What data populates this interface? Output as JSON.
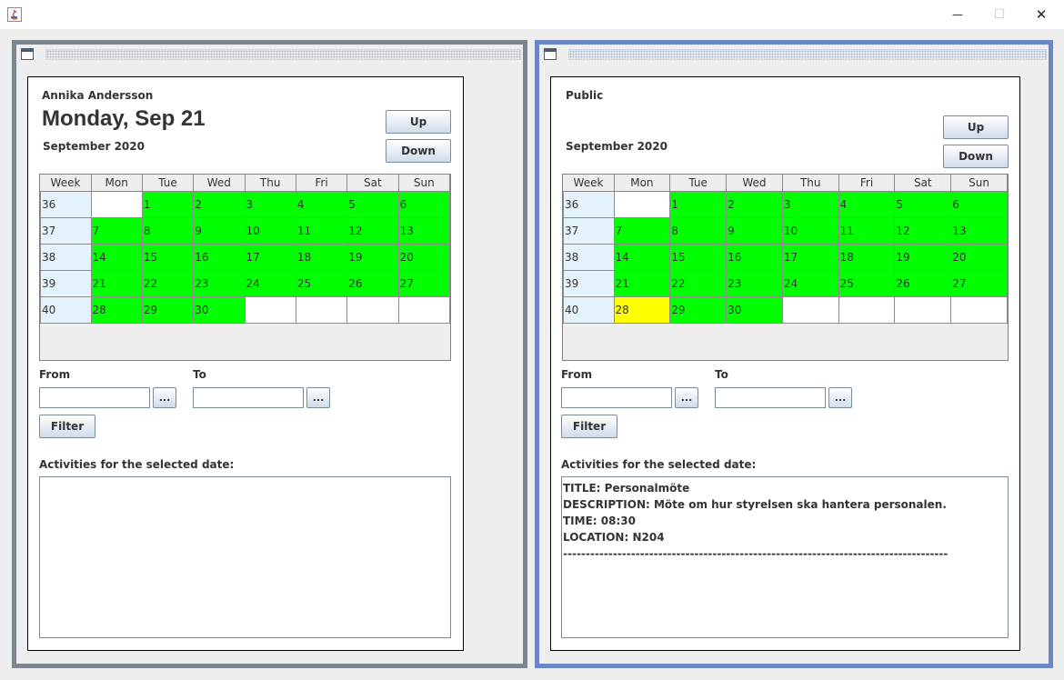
{
  "window": {
    "minimize_glyph": "—",
    "maximize_glyph": "☐",
    "close_glyph": "✕",
    "app_icon": "java-icon"
  },
  "calendar_common": {
    "weekday_headers": [
      "Week",
      "Mon",
      "Tue",
      "Wed",
      "Thu",
      "Fri",
      "Sat",
      "Sun"
    ]
  },
  "left": {
    "user_name": "Annika Andersson",
    "selected_date_label": "Monday, Sep 21",
    "month_label": "September  2020",
    "up_label": "Up",
    "down_label": "Down",
    "from_label": "From",
    "to_label": "To",
    "ellipsis_label": "...",
    "filter_label": "Filter",
    "activities_label": "Activities for the selected date:",
    "rows": [
      {
        "week": "36",
        "days": [
          "",
          "1",
          "2",
          "3",
          "4",
          "5",
          "6"
        ]
      },
      {
        "week": "37",
        "days": [
          "7",
          "8",
          "9",
          "10",
          "11",
          "12",
          "13"
        ]
      },
      {
        "week": "38",
        "days": [
          "14",
          "15",
          "16",
          "17",
          "18",
          "19",
          "20"
        ]
      },
      {
        "week": "39",
        "days": [
          "21",
          "22",
          "23",
          "24",
          "25",
          "26",
          "27"
        ]
      },
      {
        "week": "40",
        "days": [
          "28",
          "29",
          "30",
          "",
          "",
          "",
          ""
        ]
      }
    ],
    "activities": []
  },
  "right": {
    "calendar_name": "Public",
    "month_label": "September  2020",
    "up_label": "Up",
    "down_label": "Down",
    "from_label": "From",
    "to_label": "To",
    "ellipsis_label": "...",
    "filter_label": "Filter",
    "activities_label": "Activities for the selected date:",
    "selected_day": "28",
    "rows": [
      {
        "week": "36",
        "days": [
          "",
          "1",
          "2",
          "3",
          "4",
          "5",
          "6"
        ]
      },
      {
        "week": "37",
        "days": [
          "7",
          "8",
          "9",
          "10",
          "11",
          "12",
          "13"
        ]
      },
      {
        "week": "38",
        "days": [
          "14",
          "15",
          "16",
          "17",
          "18",
          "19",
          "20"
        ]
      },
      {
        "week": "39",
        "days": [
          "21",
          "22",
          "23",
          "24",
          "25",
          "26",
          "27"
        ]
      },
      {
        "week": "40",
        "days": [
          "28",
          "29",
          "30",
          "",
          "",
          "",
          ""
        ]
      }
    ],
    "activities": [
      "TITLE: Personalmöte",
      "DESCRIPTION: Möte om hur styrelsen ska hantera personalen.",
      "TIME: 08:30",
      "LOCATION: N204",
      "-------------------------------------------------------------------------------------"
    ]
  },
  "colors": {
    "day_with_activity": "#00ff00",
    "selected_day": "#ffff00",
    "week_column": "#e4f2fc",
    "empty_cell": "#ffffff",
    "left_frame_border": "#7d8590",
    "right_frame_border": "#6b86c4"
  }
}
